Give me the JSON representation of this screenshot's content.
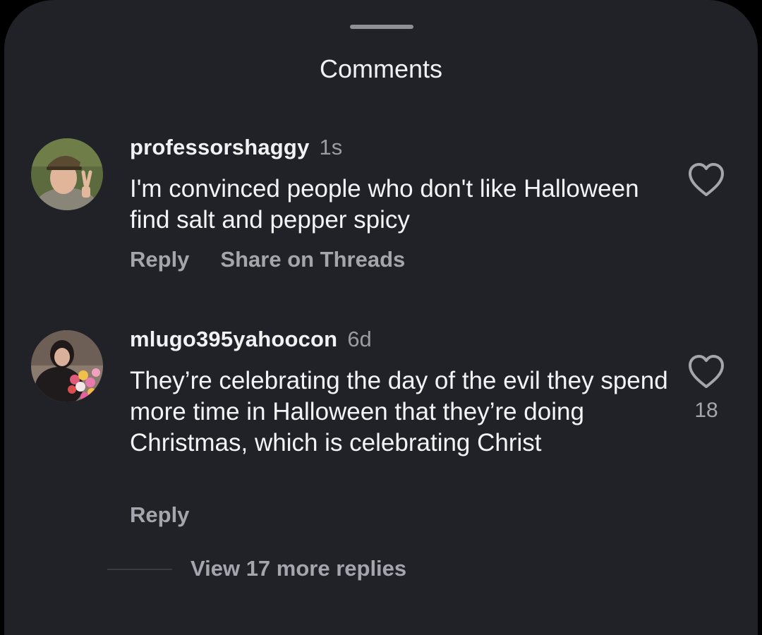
{
  "sheet": {
    "title": "Comments"
  },
  "comments": [
    {
      "username": "professorshaggy",
      "time": "1s",
      "text": "I'm convinced people who don't like Halloween find salt and pepper spicy",
      "actions": [
        "Reply",
        "Share on Threads"
      ],
      "like_icon": "heart-outline-icon",
      "like_count": ""
    },
    {
      "username": "mlugo395yahoocon",
      "time": "6d",
      "text": "They’re celebrating the day of the evil they spend more time in Halloween that they’re doing Christmas, which is celebrating Christ",
      "actions": [
        "Reply"
      ],
      "like_icon": "heart-outline-icon",
      "like_count": "18"
    }
  ],
  "replies": {
    "view_more_label": "View 17 more replies"
  },
  "colors": {
    "background": "#212227",
    "primary_text": "#f2f2f4",
    "secondary_text": "#a4a6ad"
  }
}
